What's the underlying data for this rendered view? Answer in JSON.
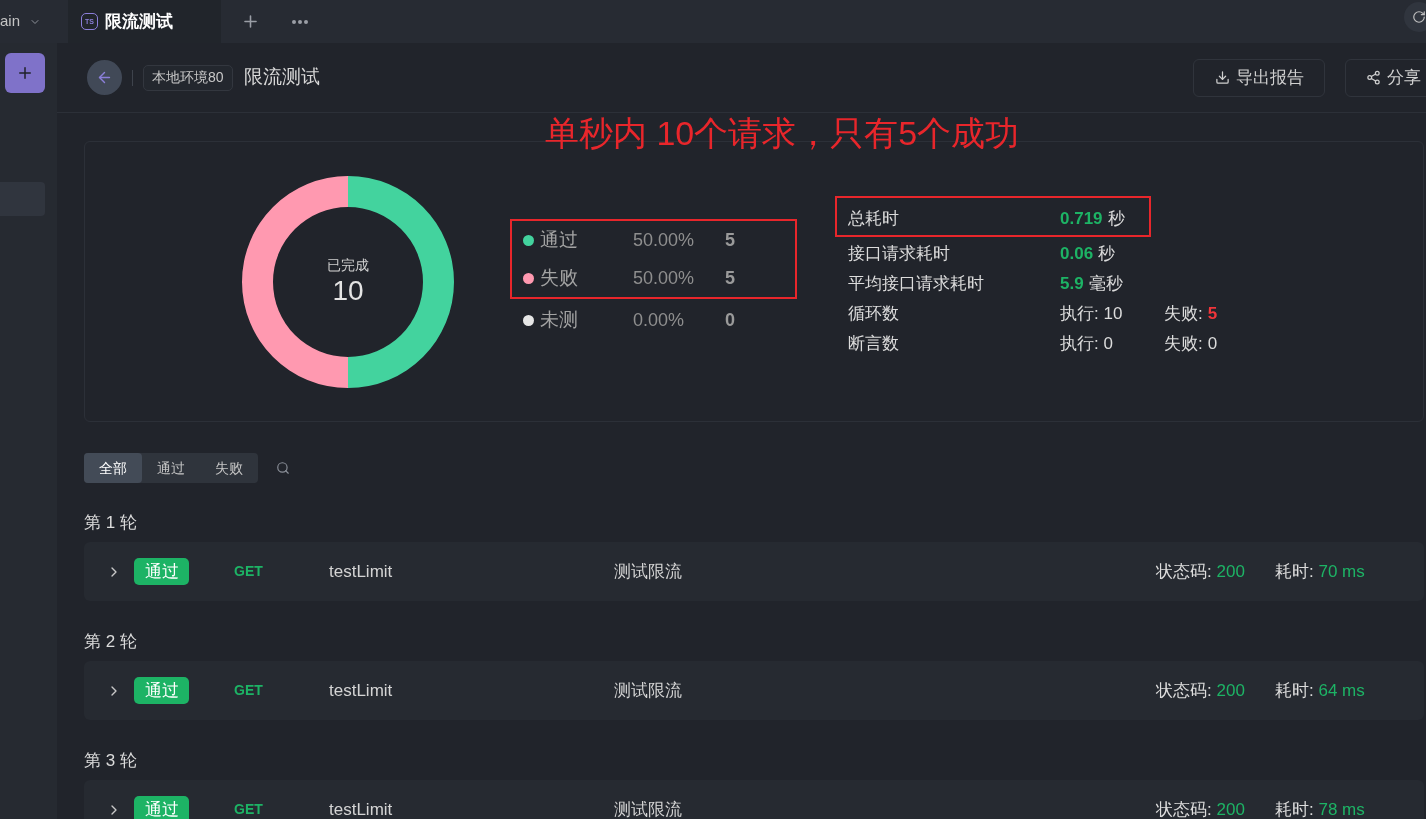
{
  "top_bar": {
    "workspace": "ain",
    "tabs": [
      {
        "badge": "TS",
        "label": "限流测试",
        "selected": true
      }
    ]
  },
  "sidebar": {
    "items": [
      {
        "selected": true
      }
    ]
  },
  "header": {
    "environment": "本地环境80",
    "title": "限流测试",
    "buttons": [
      {
        "kind": "export",
        "label": "导出报告"
      },
      {
        "kind": "share",
        "label": "分享"
      }
    ]
  },
  "annotation": {
    "text": "单秒内 10个请求，只有5个成功"
  },
  "summary": {
    "chart_data": {
      "type": "donut",
      "categories": [
        "通过",
        "失败",
        "未测"
      ],
      "values": [
        50,
        50,
        0
      ],
      "colors": [
        "#43d39e",
        "#ff99b0",
        "#e6e6e6"
      ]
    },
    "center_label": "已完成",
    "center_value": "10",
    "legend": [
      {
        "percent": "50.00%",
        "count": "5",
        "highlighted": true
      },
      {
        "percent": "50.00%",
        "count": "5",
        "highlighted": true
      },
      {
        "percent": "0.00%",
        "count": "0",
        "highlighted": false
      }
    ],
    "stats": [
      {
        "kind": "time",
        "label": "总耗时",
        "value": "0.719",
        "unit": "秒",
        "highlighted": true
      },
      {
        "kind": "time",
        "label": "接口请求耗时",
        "value": "0.06",
        "unit": "秒",
        "highlighted": false
      },
      {
        "kind": "time",
        "label": "平均接口请求耗时",
        "value": "5.9",
        "unit": "毫秒",
        "highlighted": false
      },
      {
        "kind": "count",
        "label": "循环数",
        "executed": "执行: 10",
        "failed_label": "失败:",
        "failed": "5",
        "failed_alert": true,
        "highlighted": false
      },
      {
        "kind": "count",
        "label": "断言数",
        "executed": "执行: 0",
        "failed_label": "失败:",
        "failed": "0",
        "failed_alert": false,
        "highlighted": false
      }
    ]
  },
  "filters": [
    {
      "label": "全部",
      "selected": true
    },
    {
      "label": "通过",
      "selected": false
    },
    {
      "label": "失败",
      "selected": false
    }
  ],
  "rounds": [
    {
      "title": "第 1 轮",
      "request": {
        "status": "通过",
        "method": "GET",
        "name": "testLimit",
        "description": "测试限流",
        "status_code_label": "状态码:",
        "status_code": "200",
        "time_label": "耗时:",
        "time": "70 ms"
      }
    },
    {
      "title": "第 2 轮",
      "request": {
        "status": "通过",
        "method": "GET",
        "name": "testLimit",
        "description": "测试限流",
        "status_code_label": "状态码:",
        "status_code": "200",
        "time_label": "耗时:",
        "time": "64 ms"
      }
    },
    {
      "title": "第 3 轮",
      "request": {
        "status": "通过",
        "method": "GET",
        "name": "testLimit",
        "description": "测试限流",
        "status_code_label": "状态码:",
        "status_code": "200",
        "time_label": "耗时:",
        "time": "78 ms"
      }
    }
  ]
}
